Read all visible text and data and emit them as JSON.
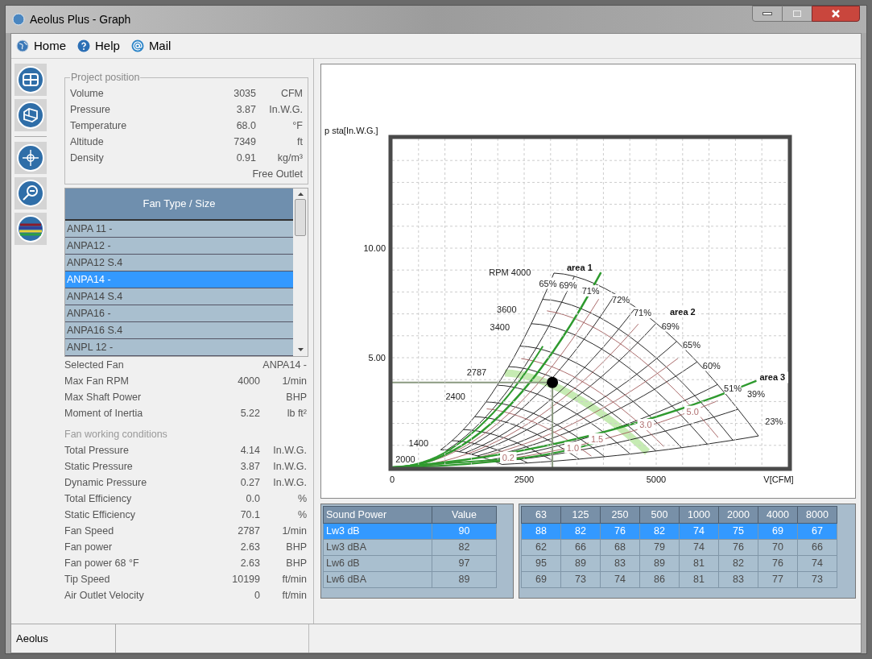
{
  "window": {
    "title": "Aeolus Plus - Graph"
  },
  "menu": [
    {
      "label": "Home",
      "kind": "globe"
    },
    {
      "label": "Help",
      "kind": "help"
    },
    {
      "label": "Mail",
      "kind": "mail"
    }
  ],
  "project_position": {
    "title": "Project position",
    "rows": [
      {
        "label": "Volume",
        "value": "3035",
        "unit": "CFM"
      },
      {
        "label": "Pressure",
        "value": "3.87",
        "unit": "In.W.G."
      },
      {
        "label": "Temperature",
        "value": "68.0",
        "unit": "°F"
      },
      {
        "label": "Altitude",
        "value": "7349",
        "unit": "ft"
      },
      {
        "label": "Density",
        "value": "0.91",
        "unit": "kg/m³"
      }
    ],
    "note": "Free Outlet"
  },
  "fan_list": {
    "header": "Fan Type / Size",
    "items": [
      {
        "label": "ANPA 11 -",
        "selected": false
      },
      {
        "label": "ANPA12 -",
        "selected": false
      },
      {
        "label": "ANPA12 S.4",
        "selected": false
      },
      {
        "label": "ANPA14 -",
        "selected": true
      },
      {
        "label": "ANPA14 S.4",
        "selected": false
      },
      {
        "label": "ANPA16 -",
        "selected": false
      },
      {
        "label": "ANPA16 S.4",
        "selected": false
      },
      {
        "label": "ANPL 12 -",
        "selected": false
      }
    ]
  },
  "fan_info": [
    {
      "label": "Selected Fan",
      "value": "ANPA14 -"
    },
    {
      "label": "Max Fan RPM",
      "value": "4000",
      "unit": "1/min"
    },
    {
      "label": "Max Shaft Power",
      "unit": "BHP"
    },
    {
      "label": "Moment of Inertia",
      "value": "5.22",
      "unit": "lb ft²"
    }
  ],
  "working_conditions": {
    "title": "Fan working conditions",
    "rows": [
      {
        "label": "Total Pressure",
        "value": "4.14",
        "unit": "In.W.G."
      },
      {
        "label": "Static Pressure",
        "value": "3.87",
        "unit": "In.W.G."
      },
      {
        "label": "Dynamic Pressure",
        "value": "0.27",
        "unit": "In.W.G."
      },
      {
        "label": "Total Efficiency",
        "value": "0.0",
        "unit": "%"
      },
      {
        "label": "Static Efficiency",
        "value": "70.1",
        "unit": "%"
      },
      {
        "label": "Fan Speed",
        "value": "2787",
        "unit": "1/min"
      },
      {
        "label": "Fan power",
        "value": "2.63",
        "unit": "BHP"
      },
      {
        "label": "Fan power 68 °F",
        "value": "2.63",
        "unit": "BHP"
      },
      {
        "label": "Tip Speed",
        "value": "10199",
        "unit": "ft/min"
      },
      {
        "label": "Air Outlet Velocity",
        "value": "0",
        "unit": "ft/min"
      }
    ]
  },
  "chart": {
    "chart_data": {
      "type": "scatter",
      "xlabel": "V[CFM]",
      "ylabel": "p sta[In.W.G.]",
      "x": [
        3035
      ],
      "series": [
        {
          "color": "#000000",
          "values": [
            3.87
          ]
        }
      ],
      "xlim": [
        0,
        7500
      ],
      "ylim": [
        0,
        15
      ],
      "xticks": [
        0,
        2500,
        5000
      ],
      "yticks": [
        {
          "value": 5,
          "label": "5.00"
        },
        {
          "value": 10,
          "label": "10.00"
        }
      ],
      "grid": true,
      "annotations": [
        "area 1",
        "65%",
        "69%",
        "71%",
        "72%",
        "71%",
        "area 2",
        "69%",
        "65%",
        "60%",
        "51%",
        "area 3",
        "39%",
        "23%",
        "RPM 4000",
        "3600",
        "3400",
        "2787",
        "2400",
        "1400",
        "2000",
        "0.2",
        "1.0",
        "1.5",
        "3.0",
        "5.0"
      ]
    }
  },
  "sound_power": {
    "columns": [
      "Sound Power",
      "Value"
    ],
    "rows": [
      {
        "cells": [
          "Lw3 dB",
          "90"
        ],
        "selected": true
      },
      {
        "cells": [
          "Lw3 dBA",
          "82"
        ],
        "selected": false
      },
      {
        "cells": [
          "Lw6 dB",
          "97"
        ],
        "selected": false
      },
      {
        "cells": [
          "Lw6 dBA",
          "89"
        ],
        "selected": false
      }
    ]
  },
  "octave_bands": {
    "columns": [
      "63",
      "125",
      "250",
      "500",
      "1000",
      "2000",
      "4000",
      "8000"
    ],
    "rows": [
      {
        "cells": [
          "88",
          "82",
          "76",
          "82",
          "74",
          "75",
          "69",
          "67"
        ],
        "selected": true
      },
      {
        "cells": [
          "62",
          "66",
          "68",
          "79",
          "74",
          "76",
          "70",
          "66"
        ],
        "selected": false
      },
      {
        "cells": [
          "95",
          "89",
          "83",
          "89",
          "81",
          "82",
          "76",
          "74"
        ],
        "selected": false
      },
      {
        "cells": [
          "69",
          "73",
          "74",
          "86",
          "81",
          "83",
          "77",
          "73"
        ],
        "selected": false
      }
    ]
  },
  "status_bar": [
    "Aeolus"
  ]
}
